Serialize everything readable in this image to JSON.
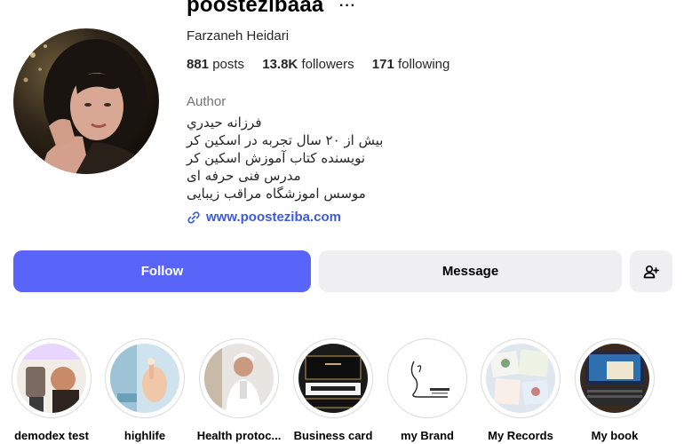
{
  "profile": {
    "username": "poostezibaaa",
    "more_glyph": "···",
    "full_name": "Farzaneh Heidari",
    "category": "Author",
    "bio_lines": [
      "فرزانه حیدري",
      "بیش از ۲۰ سال تجربه در اسکین کر",
      "نویسنده کتاب آموزش اسکین کر",
      "مدرس فنی حرفه ای",
      "موسس اموزشگاه مراقب زیبایی"
    ],
    "website": "www.poosteziba.com"
  },
  "stats": {
    "posts_count": "881",
    "posts_label": "posts",
    "followers_count": "13.8K",
    "followers_label": "followers",
    "following_count": "171",
    "following_label": "following"
  },
  "actions": {
    "follow_label": "Follow",
    "message_label": "Message"
  },
  "highlights": [
    {
      "label": "demodex test"
    },
    {
      "label": "highlife"
    },
    {
      "label": "Health protoc..."
    },
    {
      "label": "Business card"
    },
    {
      "label": "my Brand"
    },
    {
      "label": "My Records"
    },
    {
      "label": "My book"
    }
  ],
  "colors": {
    "follow_button": "#5865f8",
    "secondary_button": "#efeff2",
    "link": "#3b5bdb",
    "muted": "#737373"
  },
  "icons": {
    "link": "link-icon",
    "more": "more-options-icon",
    "suggest": "add-person-icon"
  }
}
